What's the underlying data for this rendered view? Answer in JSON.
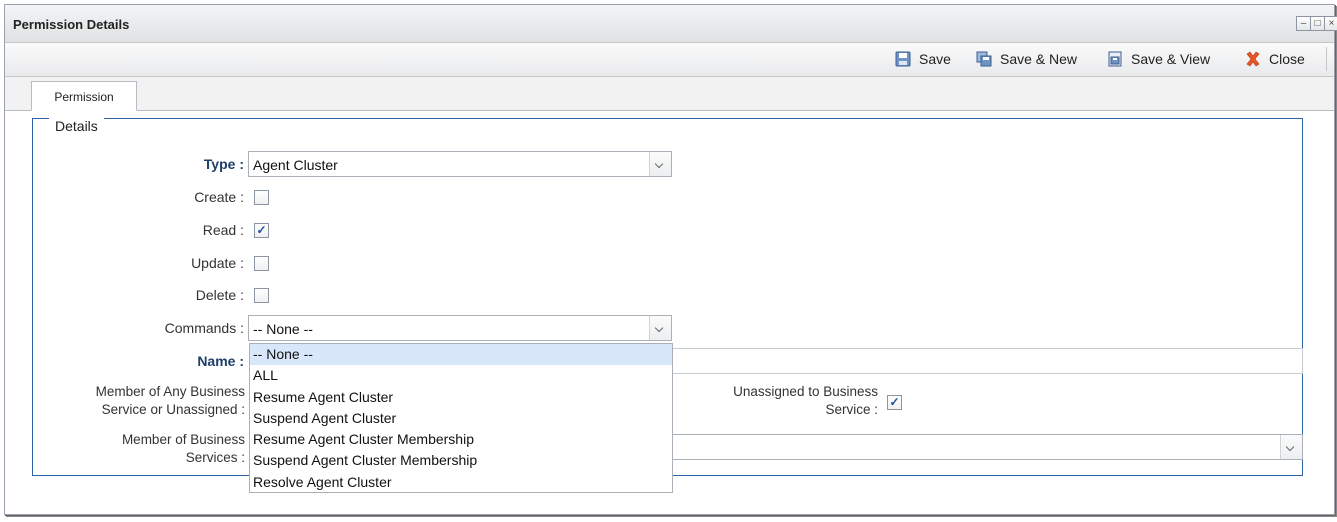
{
  "window": {
    "title": "Permission Details"
  },
  "toolbar": {
    "save": "Save",
    "save_new": "Save & New",
    "save_view": "Save & View",
    "close": "Close"
  },
  "tabs": [
    {
      "label": "Permission"
    }
  ],
  "details": {
    "legend": "Details",
    "type_label": "Type :",
    "type_value": "Agent Cluster",
    "create_label": "Create :",
    "create_checked": false,
    "read_label": "Read :",
    "read_checked": true,
    "update_label": "Update :",
    "update_checked": false,
    "delete_label": "Delete :",
    "delete_checked": false,
    "commands_label": "Commands :",
    "commands_value": "-- None --",
    "name_label": "Name :",
    "name_value": "",
    "member_any_label_1": "Member of Any Business",
    "member_any_label_2": "Service or Unassigned :",
    "unassigned_label_1": "Unassigned to Business",
    "unassigned_label_2": "Service :",
    "unassigned_checked": true,
    "member_bs_label_1": "Member of Business",
    "member_bs_label_2": "Services :",
    "member_bs_value": ""
  },
  "commands_options": [
    "-- None --",
    "ALL",
    "Resume Agent Cluster",
    "Suspend Agent Cluster",
    "Resume Agent Cluster Membership",
    "Suspend Agent Cluster Membership",
    "Resolve Agent Cluster"
  ],
  "colors": {
    "accent_border": "#2f63a5",
    "label_bold": "#1f3f6b",
    "selected_option": "#d8e8fa"
  }
}
